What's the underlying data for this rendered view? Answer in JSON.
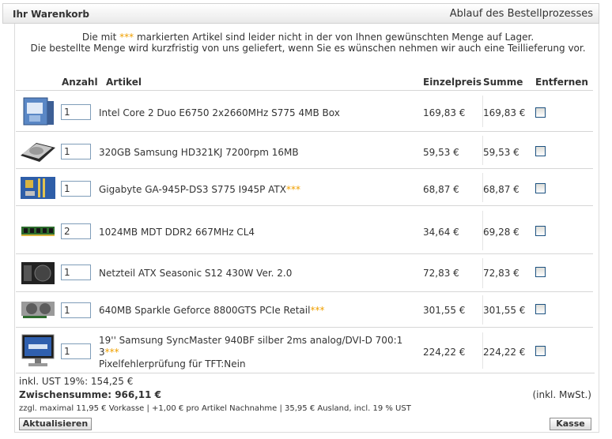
{
  "header": {
    "title": "Ihr Warenkorb",
    "process_link": "Ablauf des Bestellprozesses"
  },
  "notice": {
    "line1_pre": "Die mit ",
    "marker": "***",
    "line1_post": " markierten Artikel sind leider nicht in der von Ihnen gewünschten Menge auf Lager.",
    "line2": "Die bestellte Menge wird kurzfristig von uns geliefert, wenn Sie es wünschen nehmen wir auch eine Teillieferung vor."
  },
  "columns": {
    "quantity": "Anzahl",
    "article": "Artikel",
    "unit_price": "Einzelpreis",
    "sum": "Summe",
    "remove": "Entfernen"
  },
  "items": [
    {
      "qty": "1",
      "name": "Intel Core 2 Duo E6750 2x2660MHz S775 4MB Box",
      "marker": "",
      "extra": "",
      "unit_price": "169,83 €",
      "sum": "169,83 €",
      "image": "cpu-box-icon"
    },
    {
      "qty": "1",
      "name": "320GB Samsung HD321KJ 7200rpm 16MB",
      "marker": "",
      "extra": "",
      "unit_price": "59,53 €",
      "sum": "59,53 €",
      "image": "hard-drive-icon"
    },
    {
      "qty": "1",
      "name": "Gigabyte GA-945P-DS3 S775 I945P ATX",
      "marker": "***",
      "extra": "",
      "unit_price": "68,87 €",
      "sum": "68,87 €",
      "image": "motherboard-icon"
    },
    {
      "qty": "2",
      "name": "1024MB MDT DDR2 667MHz CL4",
      "marker": "",
      "extra": "",
      "unit_price": "34,64 €",
      "sum": "69,28 €",
      "image": "ram-module-icon"
    },
    {
      "qty": "1",
      "name": "Netzteil ATX Seasonic S12 430W Ver. 2.0",
      "marker": "",
      "extra": "",
      "unit_price": "72,83 €",
      "sum": "72,83 €",
      "image": "power-supply-icon"
    },
    {
      "qty": "1",
      "name": "640MB Sparkle Geforce 8800GTS PCIe Retail",
      "marker": "***",
      "extra": "",
      "unit_price": "301,55 €",
      "sum": "301,55 €",
      "image": "graphics-card-icon"
    },
    {
      "qty": "1",
      "name": "19'' Samsung SyncMaster 940BF silber 2ms analog/DVI-D 700:1",
      "name2": "3",
      "marker": "***",
      "extra": "Pixelfehlerprüfung für TFT:Nein",
      "unit_price": "224,22 €",
      "sum": "224,22 €",
      "image": "monitor-icon"
    }
  ],
  "totals": {
    "tax": "inkl. UST 19%: 154,25 €",
    "subtotal": "Zwischensumme: 966,11 €",
    "incl_vat": "(inkl. MwSt.)",
    "shipping": "zzgl. maximal 11,95 € Vorkasse | +1,00 € pro Artikel Nachnahme | 35,95 € Ausland, incl. 19 % UST"
  },
  "buttons": {
    "update": "Aktualisieren",
    "checkout": "Kasse"
  },
  "colors": {
    "marker": "#f0a000",
    "header_bg": "#e9e9e9",
    "border": "#d6d6d6"
  }
}
